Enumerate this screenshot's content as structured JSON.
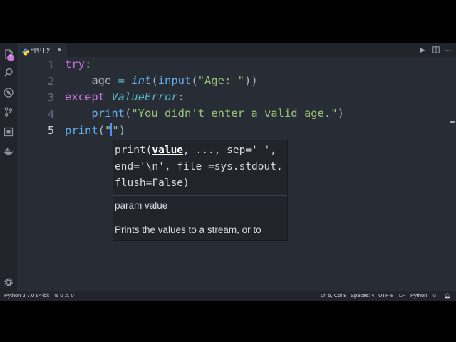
{
  "tab": {
    "label": "app.py",
    "icon": "python-file-icon"
  },
  "editor": {
    "line_numbers": [
      "1",
      "2",
      "3",
      "4",
      "5"
    ],
    "code": {
      "l1_kw": "try",
      "l1_p": ":",
      "l2_indent": "    ",
      "l2_var": "age",
      "l2_eq": " = ",
      "l2_int": "int",
      "l2_paren1": "(",
      "l2_input": "input",
      "l2_paren2": "(",
      "l2_str": "\"Age: \"",
      "l2_close": "))",
      "l3_kw": "except",
      "l3_sp": " ",
      "l3_cls": "ValueError",
      "l3_p": ":",
      "l4_indent": "    ",
      "l4_fn": "print",
      "l4_open": "(",
      "l4_str": "\"You didn't enter a valid age.\"",
      "l4_close": ")",
      "l5_fn": "print",
      "l5_open": "(",
      "l5_q1": "\"",
      "l5_q2": "\"",
      "l5_close": ")"
    }
  },
  "hint": {
    "sig_pre": "print(",
    "sig_param": "value",
    "sig_post": ", ..., sep=' ', end='\\n', file =sys.stdout, flush=False)",
    "param": "param value",
    "doc": "Prints the values to a stream, or to sys.stdout by default."
  },
  "status": {
    "interpreter": "Python 3.7.0 64-bit",
    "errors": "0",
    "warnings": "0",
    "position": "Ln 5, Col 8",
    "spaces": "Spaces: 4",
    "encoding": "UTF-8",
    "eol": "LF",
    "language": "Python"
  },
  "colors": {
    "background": "#282c34",
    "keyword": "#c678dd",
    "function": "#61afef",
    "string": "#98c379",
    "class": "#56b6c2"
  }
}
